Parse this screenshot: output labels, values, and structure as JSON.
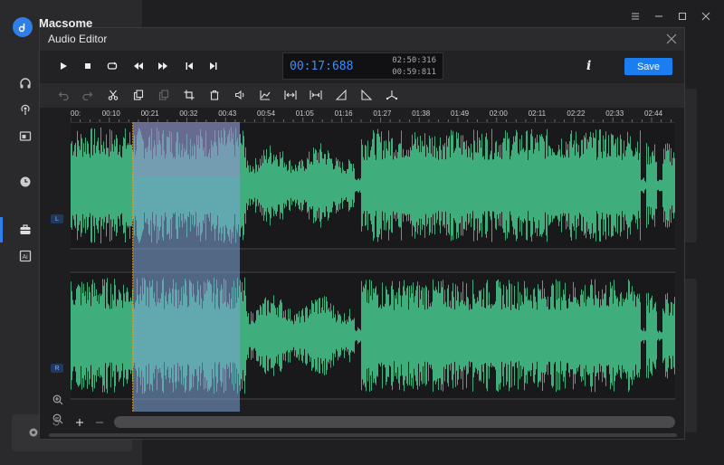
{
  "app": {
    "name": "Macsome",
    "logo_letter": "♪"
  },
  "dialog": {
    "title": "Audio Editor",
    "save_label": "Save",
    "info_label": "i"
  },
  "time": {
    "current": "00:17:688",
    "total": "02:50:316",
    "duration": "00:59:811"
  },
  "ruler": {
    "labels": [
      "00:",
      "00:10",
      "00:21",
      "00:32",
      "00:43",
      "00:54",
      "01:05",
      "01:16",
      "01:27",
      "01:38",
      "01:49",
      "02:00",
      "02:11",
      "02:22",
      "02:33",
      "02:44"
    ]
  },
  "channels": {
    "left": "L",
    "right": "R"
  },
  "selection": {
    "start_fraction": 0.103,
    "end_fraction": 0.28
  },
  "colors": {
    "wave": "#3fae7c",
    "selection": "#7ea6d8",
    "accent": "#1a7ef0",
    "time": "#3d8bfd"
  }
}
